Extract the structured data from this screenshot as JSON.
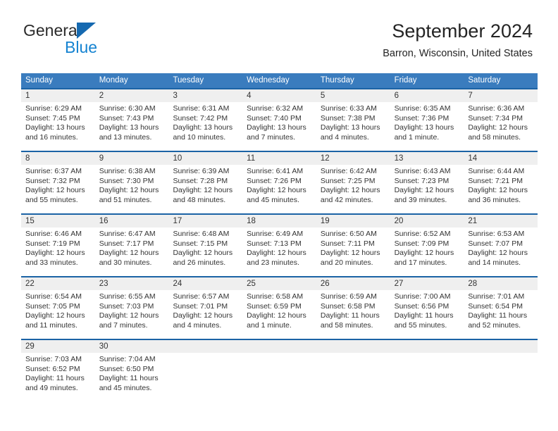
{
  "logo": {
    "word1": "General",
    "word2": "Blue",
    "triangle_color": "#1569b0",
    "blue_text_color": "#1583d1"
  },
  "header": {
    "title": "September 2024",
    "subtitle": "Barron, Wisconsin, United States"
  },
  "theme": {
    "header_row_bg": "#3a7cbe",
    "week_separator": "#1b63a5",
    "daynum_band_bg": "#efefef",
    "text": "#333333"
  },
  "weekdays": [
    "Sunday",
    "Monday",
    "Tuesday",
    "Wednesday",
    "Thursday",
    "Friday",
    "Saturday"
  ],
  "weeks": [
    {
      "days": [
        {
          "num": "1",
          "sunrise": "Sunrise: 6:29 AM",
          "sunset": "Sunset: 7:45 PM",
          "daylight_line1": "Daylight: 13 hours",
          "daylight_line2": "and 16 minutes."
        },
        {
          "num": "2",
          "sunrise": "Sunrise: 6:30 AM",
          "sunset": "Sunset: 7:43 PM",
          "daylight_line1": "Daylight: 13 hours",
          "daylight_line2": "and 13 minutes."
        },
        {
          "num": "3",
          "sunrise": "Sunrise: 6:31 AM",
          "sunset": "Sunset: 7:42 PM",
          "daylight_line1": "Daylight: 13 hours",
          "daylight_line2": "and 10 minutes."
        },
        {
          "num": "4",
          "sunrise": "Sunrise: 6:32 AM",
          "sunset": "Sunset: 7:40 PM",
          "daylight_line1": "Daylight: 13 hours",
          "daylight_line2": "and 7 minutes."
        },
        {
          "num": "5",
          "sunrise": "Sunrise: 6:33 AM",
          "sunset": "Sunset: 7:38 PM",
          "daylight_line1": "Daylight: 13 hours",
          "daylight_line2": "and 4 minutes."
        },
        {
          "num": "6",
          "sunrise": "Sunrise: 6:35 AM",
          "sunset": "Sunset: 7:36 PM",
          "daylight_line1": "Daylight: 13 hours",
          "daylight_line2": "and 1 minute."
        },
        {
          "num": "7",
          "sunrise": "Sunrise: 6:36 AM",
          "sunset": "Sunset: 7:34 PM",
          "daylight_line1": "Daylight: 12 hours",
          "daylight_line2": "and 58 minutes."
        }
      ]
    },
    {
      "days": [
        {
          "num": "8",
          "sunrise": "Sunrise: 6:37 AM",
          "sunset": "Sunset: 7:32 PM",
          "daylight_line1": "Daylight: 12 hours",
          "daylight_line2": "and 55 minutes."
        },
        {
          "num": "9",
          "sunrise": "Sunrise: 6:38 AM",
          "sunset": "Sunset: 7:30 PM",
          "daylight_line1": "Daylight: 12 hours",
          "daylight_line2": "and 51 minutes."
        },
        {
          "num": "10",
          "sunrise": "Sunrise: 6:39 AM",
          "sunset": "Sunset: 7:28 PM",
          "daylight_line1": "Daylight: 12 hours",
          "daylight_line2": "and 48 minutes."
        },
        {
          "num": "11",
          "sunrise": "Sunrise: 6:41 AM",
          "sunset": "Sunset: 7:26 PM",
          "daylight_line1": "Daylight: 12 hours",
          "daylight_line2": "and 45 minutes."
        },
        {
          "num": "12",
          "sunrise": "Sunrise: 6:42 AM",
          "sunset": "Sunset: 7:25 PM",
          "daylight_line1": "Daylight: 12 hours",
          "daylight_line2": "and 42 minutes."
        },
        {
          "num": "13",
          "sunrise": "Sunrise: 6:43 AM",
          "sunset": "Sunset: 7:23 PM",
          "daylight_line1": "Daylight: 12 hours",
          "daylight_line2": "and 39 minutes."
        },
        {
          "num": "14",
          "sunrise": "Sunrise: 6:44 AM",
          "sunset": "Sunset: 7:21 PM",
          "daylight_line1": "Daylight: 12 hours",
          "daylight_line2": "and 36 minutes."
        }
      ]
    },
    {
      "days": [
        {
          "num": "15",
          "sunrise": "Sunrise: 6:46 AM",
          "sunset": "Sunset: 7:19 PM",
          "daylight_line1": "Daylight: 12 hours",
          "daylight_line2": "and 33 minutes."
        },
        {
          "num": "16",
          "sunrise": "Sunrise: 6:47 AM",
          "sunset": "Sunset: 7:17 PM",
          "daylight_line1": "Daylight: 12 hours",
          "daylight_line2": "and 30 minutes."
        },
        {
          "num": "17",
          "sunrise": "Sunrise: 6:48 AM",
          "sunset": "Sunset: 7:15 PM",
          "daylight_line1": "Daylight: 12 hours",
          "daylight_line2": "and 26 minutes."
        },
        {
          "num": "18",
          "sunrise": "Sunrise: 6:49 AM",
          "sunset": "Sunset: 7:13 PM",
          "daylight_line1": "Daylight: 12 hours",
          "daylight_line2": "and 23 minutes."
        },
        {
          "num": "19",
          "sunrise": "Sunrise: 6:50 AM",
          "sunset": "Sunset: 7:11 PM",
          "daylight_line1": "Daylight: 12 hours",
          "daylight_line2": "and 20 minutes."
        },
        {
          "num": "20",
          "sunrise": "Sunrise: 6:52 AM",
          "sunset": "Sunset: 7:09 PM",
          "daylight_line1": "Daylight: 12 hours",
          "daylight_line2": "and 17 minutes."
        },
        {
          "num": "21",
          "sunrise": "Sunrise: 6:53 AM",
          "sunset": "Sunset: 7:07 PM",
          "daylight_line1": "Daylight: 12 hours",
          "daylight_line2": "and 14 minutes."
        }
      ]
    },
    {
      "days": [
        {
          "num": "22",
          "sunrise": "Sunrise: 6:54 AM",
          "sunset": "Sunset: 7:05 PM",
          "daylight_line1": "Daylight: 12 hours",
          "daylight_line2": "and 11 minutes."
        },
        {
          "num": "23",
          "sunrise": "Sunrise: 6:55 AM",
          "sunset": "Sunset: 7:03 PM",
          "daylight_line1": "Daylight: 12 hours",
          "daylight_line2": "and 7 minutes."
        },
        {
          "num": "24",
          "sunrise": "Sunrise: 6:57 AM",
          "sunset": "Sunset: 7:01 PM",
          "daylight_line1": "Daylight: 12 hours",
          "daylight_line2": "and 4 minutes."
        },
        {
          "num": "25",
          "sunrise": "Sunrise: 6:58 AM",
          "sunset": "Sunset: 6:59 PM",
          "daylight_line1": "Daylight: 12 hours",
          "daylight_line2": "and 1 minute."
        },
        {
          "num": "26",
          "sunrise": "Sunrise: 6:59 AM",
          "sunset": "Sunset: 6:58 PM",
          "daylight_line1": "Daylight: 11 hours",
          "daylight_line2": "and 58 minutes."
        },
        {
          "num": "27",
          "sunrise": "Sunrise: 7:00 AM",
          "sunset": "Sunset: 6:56 PM",
          "daylight_line1": "Daylight: 11 hours",
          "daylight_line2": "and 55 minutes."
        },
        {
          "num": "28",
          "sunrise": "Sunrise: 7:01 AM",
          "sunset": "Sunset: 6:54 PM",
          "daylight_line1": "Daylight: 11 hours",
          "daylight_line2": "and 52 minutes."
        }
      ]
    },
    {
      "days": [
        {
          "num": "29",
          "sunrise": "Sunrise: 7:03 AM",
          "sunset": "Sunset: 6:52 PM",
          "daylight_line1": "Daylight: 11 hours",
          "daylight_line2": "and 49 minutes."
        },
        {
          "num": "30",
          "sunrise": "Sunrise: 7:04 AM",
          "sunset": "Sunset: 6:50 PM",
          "daylight_line1": "Daylight: 11 hours",
          "daylight_line2": "and 45 minutes."
        },
        {
          "num": "",
          "sunrise": "",
          "sunset": "",
          "daylight_line1": "",
          "daylight_line2": ""
        },
        {
          "num": "",
          "sunrise": "",
          "sunset": "",
          "daylight_line1": "",
          "daylight_line2": ""
        },
        {
          "num": "",
          "sunrise": "",
          "sunset": "",
          "daylight_line1": "",
          "daylight_line2": ""
        },
        {
          "num": "",
          "sunrise": "",
          "sunset": "",
          "daylight_line1": "",
          "daylight_line2": ""
        },
        {
          "num": "",
          "sunrise": "",
          "sunset": "",
          "daylight_line1": "",
          "daylight_line2": ""
        }
      ]
    }
  ]
}
